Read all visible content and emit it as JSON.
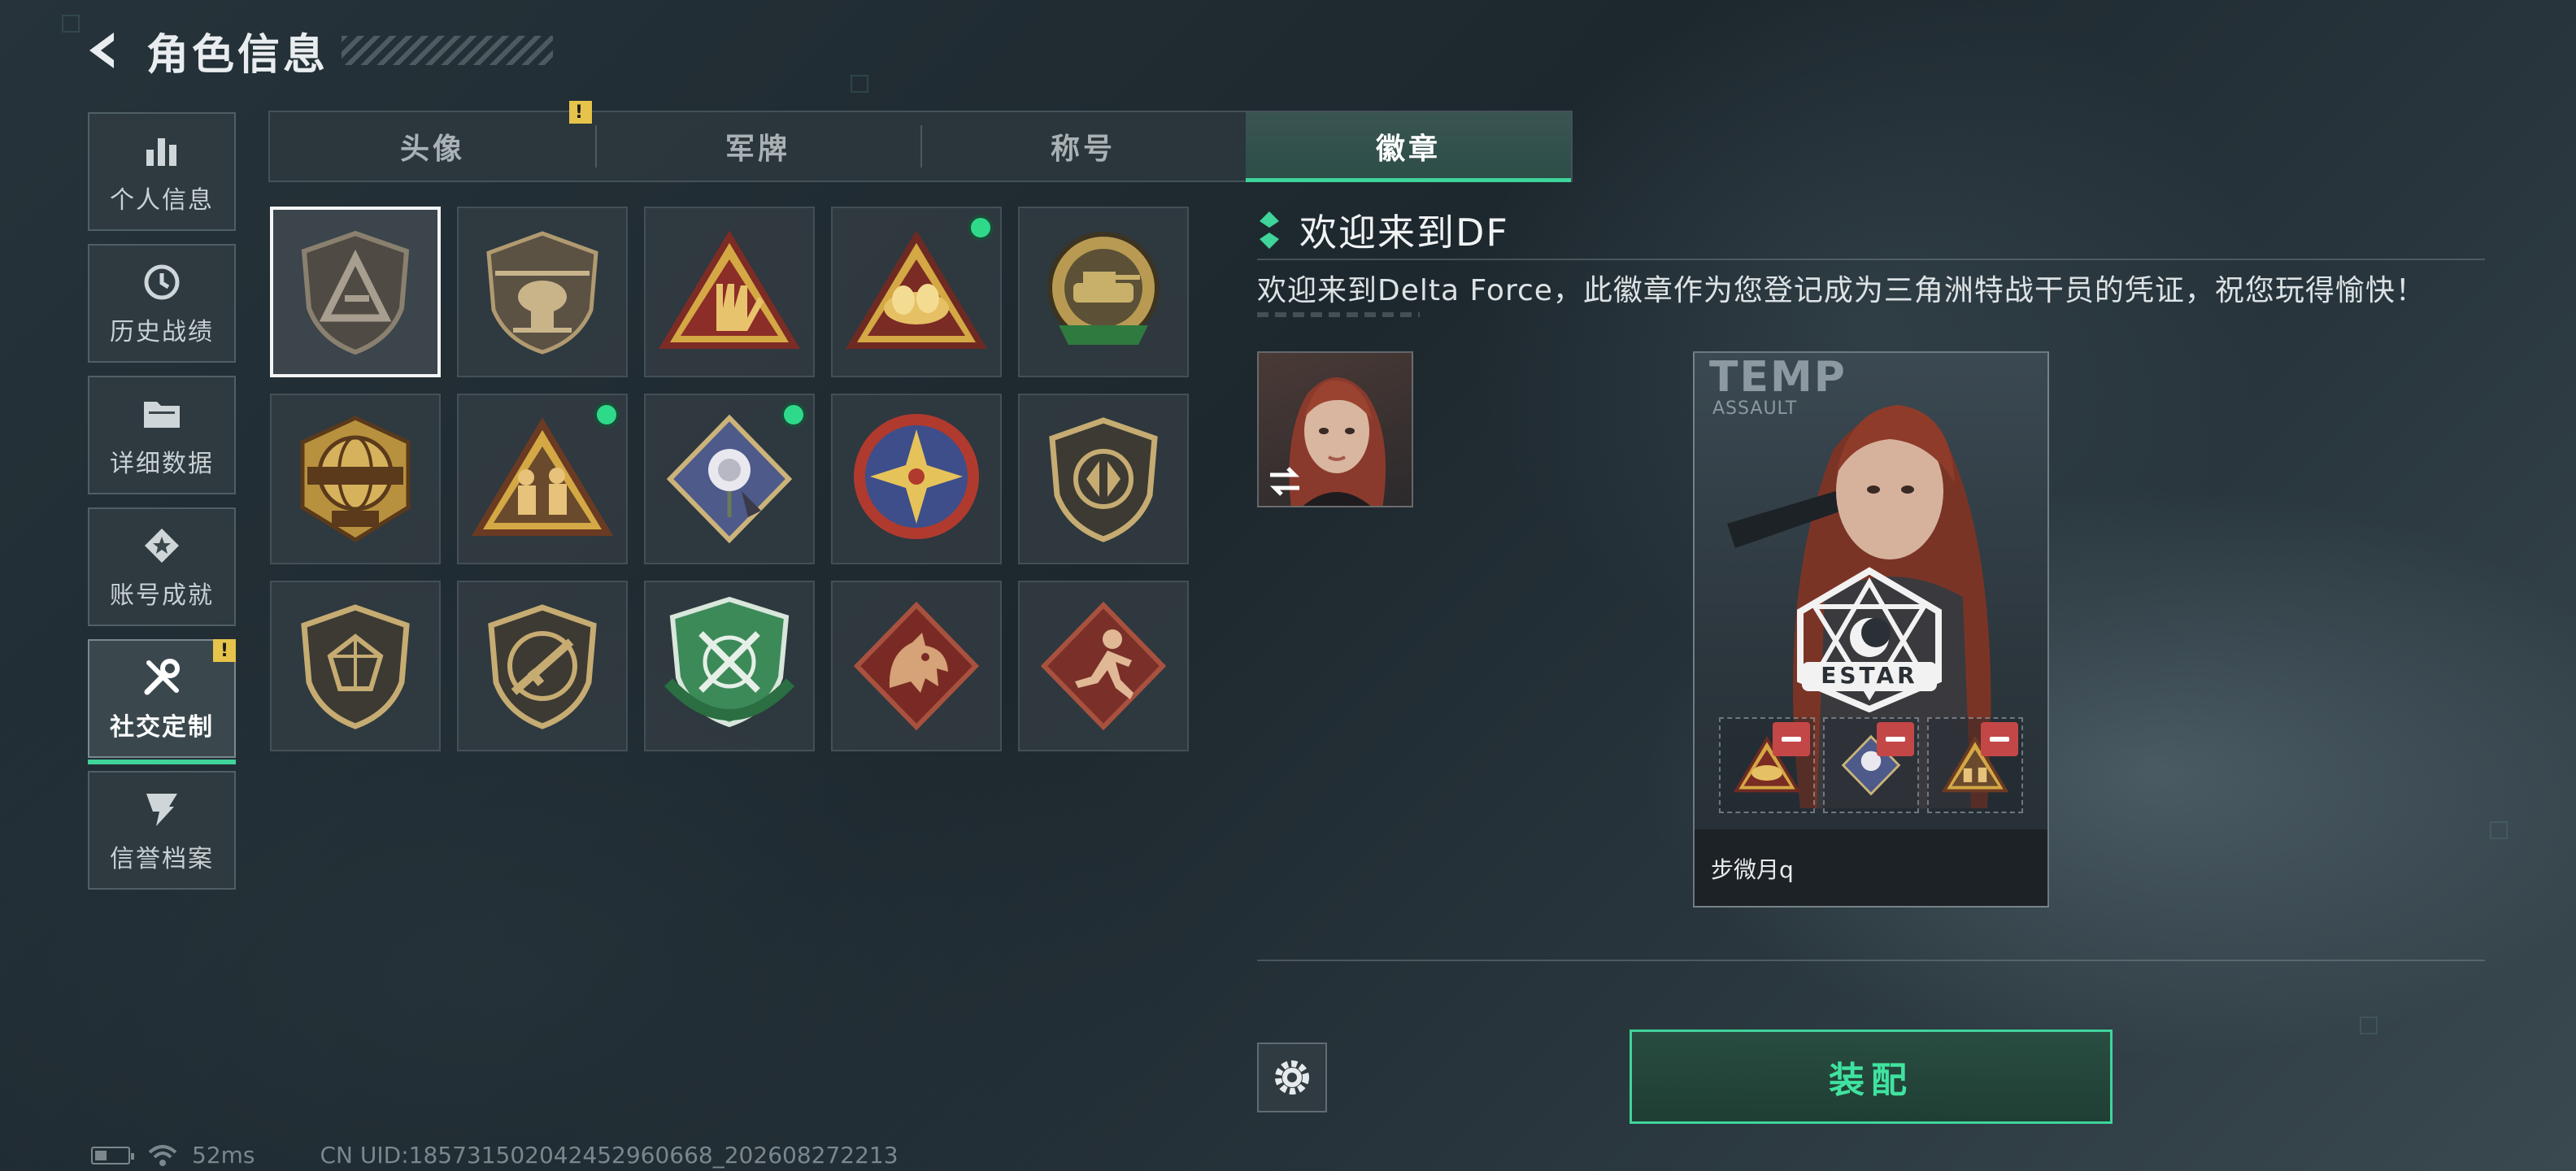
{
  "header": {
    "title": "角色信息"
  },
  "sidenav": {
    "items": [
      {
        "label": "个人信息",
        "icon": "bar-chart-icon"
      },
      {
        "label": "历史战绩",
        "icon": "history-icon"
      },
      {
        "label": "详细数据",
        "icon": "folder-icon"
      },
      {
        "label": "账号成就",
        "icon": "achievement-icon"
      },
      {
        "label": "社交定制",
        "icon": "tools-icon",
        "active": true,
        "alert": "!"
      },
      {
        "label": "信誉档案",
        "icon": "reputation-icon"
      }
    ]
  },
  "tabs": [
    {
      "label": "头像",
      "alert": "!"
    },
    {
      "label": "军牌"
    },
    {
      "label": "称号"
    },
    {
      "label": "徽章",
      "active": true
    }
  ],
  "badges": [
    {
      "icon": "delta-shield-badge",
      "selected": true
    },
    {
      "icon": "helicopter-badge"
    },
    {
      "icon": "rock-hand-badge"
    },
    {
      "icon": "nest-triangle-badge",
      "new": true
    },
    {
      "icon": "delta-force-2026-tank-badge"
    },
    {
      "icon": "delta-force-2026-globe-badge"
    },
    {
      "icon": "soldiers-triangle-badge",
      "new": true
    },
    {
      "icon": "rose-diamond-badge",
      "new": true
    },
    {
      "icon": "star-compass-badge"
    },
    {
      "icon": "arrows-shield-badge"
    },
    {
      "icon": "gem-shield-badge"
    },
    {
      "icon": "rifle-circle-badge"
    },
    {
      "icon": "green-rifles-shield-badge"
    },
    {
      "icon": "dragon-diamond-badge"
    },
    {
      "icon": "runner-diamond-badge"
    }
  ],
  "detail": {
    "name": "欢迎来到DF",
    "description": "欢迎来到Delta Force，此徽章作为您登记成为三角洲特战干员的凭证，祝您玩得愉快！"
  },
  "card": {
    "team": "TEMP",
    "subtitle": "ASSAULT",
    "emblem_text": "ESTAR",
    "player_name": "步微月q"
  },
  "actions": {
    "equip_label": "装配"
  },
  "status": {
    "ping": "52ms",
    "uid": "CN UID:18573150204245296066​8_202608272213"
  },
  "colors": {
    "accent": "#3fd49a",
    "alert": "#e6c34a",
    "remove": "#c44747",
    "new_dot": "#2fd98a"
  }
}
